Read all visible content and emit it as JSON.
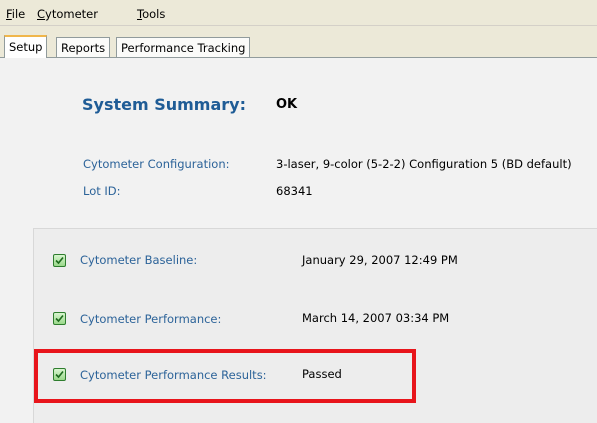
{
  "menu": {
    "file": {
      "mnemonic": "F",
      "rest": "ile"
    },
    "cytometer": {
      "mnemonic": "C",
      "rest": "ytometer"
    },
    "tools": {
      "mnemonic": "T",
      "rest": "ools"
    }
  },
  "tabs": [
    {
      "label": "Setup",
      "active": true
    },
    {
      "label": "Reports",
      "active": false
    },
    {
      "label": "Performance Tracking",
      "active": false
    }
  ],
  "summary": {
    "title": "System Summary:",
    "status": "OK"
  },
  "info": {
    "config_label": "Cytometer Configuration:",
    "config_value": "3-laser, 9-color (5-2-2) Configuration 5 (BD default)",
    "lot_label": "Lot ID:",
    "lot_value": "68341"
  },
  "checks": [
    {
      "label": "Cytometer Baseline:",
      "value": "January 29, 2007 12:49 PM",
      "checked": true
    },
    {
      "label": "Cytometer Performance:",
      "value": "March 14, 2007 03:34 PM",
      "checked": true
    },
    {
      "label": "Cytometer Performance Results:",
      "value": "Passed",
      "checked": true
    }
  ],
  "colors": {
    "accent_blue": "#1f5c96",
    "label_blue": "#2c6399",
    "highlight_red": "#e8151b",
    "check_green": "#2e7d2e",
    "menubar_bg": "#ece9d8",
    "panel_bg": "#f2f2f2"
  }
}
